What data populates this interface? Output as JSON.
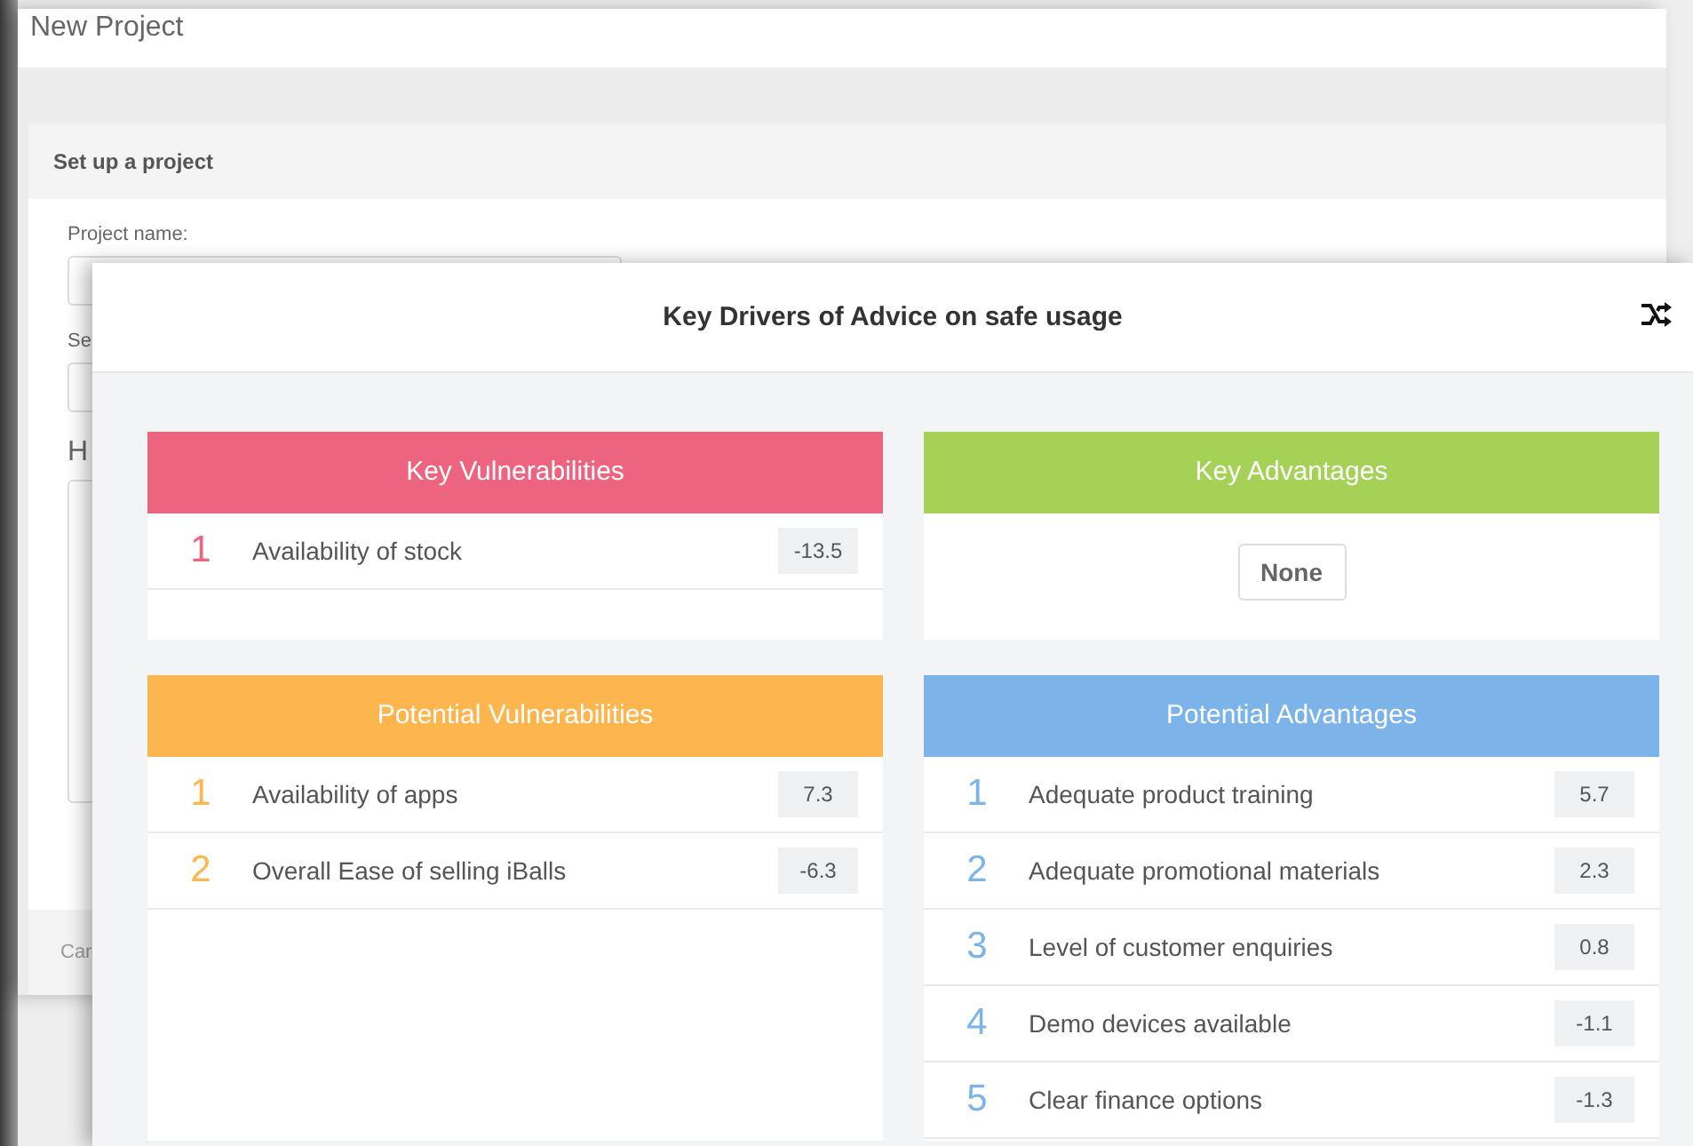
{
  "background_window": {
    "title": "New Project",
    "panel_title": "Set up a project",
    "field_label": "Project name:",
    "label_2": "Se",
    "heading": "H",
    "footer_button": "Car"
  },
  "modal": {
    "title": "Key Drivers of Advice on safe usage",
    "cards": [
      {
        "title": "Key Vulnerabilities",
        "color": "#ec6480",
        "items": [
          {
            "rank": "1",
            "label": "Availability of stock",
            "value": "-13.5"
          }
        ]
      },
      {
        "title": "Key Advantages",
        "color": "#a5d156",
        "empty_label": "None"
      },
      {
        "title": "Potential Vulnerabilities",
        "color": "#fdb54e",
        "items": [
          {
            "rank": "1",
            "label": "Availability of apps",
            "value": "7.3"
          },
          {
            "rank": "2",
            "label": "Overall Ease of selling iBalls",
            "value": "-6.3"
          }
        ]
      },
      {
        "title": "Potential Advantages",
        "color": "#7cb4e9",
        "items": [
          {
            "rank": "1",
            "label": "Adequate product training",
            "value": "5.7"
          },
          {
            "rank": "2",
            "label": "Adequate promotional materials",
            "value": "2.3"
          },
          {
            "rank": "3",
            "label": "Level of customer enquiries",
            "value": "0.8"
          },
          {
            "rank": "4",
            "label": "Demo devices available",
            "value": "-1.1"
          },
          {
            "rank": "5",
            "label": "Clear finance options",
            "value": "-1.3"
          }
        ]
      }
    ]
  }
}
